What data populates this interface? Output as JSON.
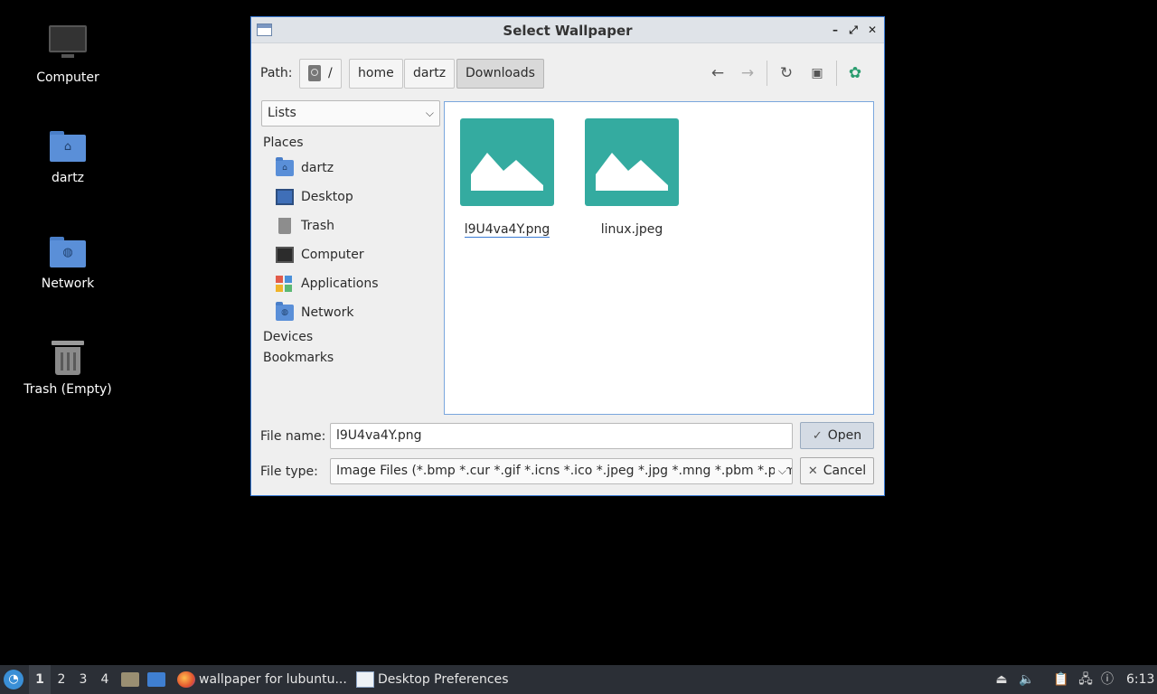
{
  "desktop": {
    "icons": [
      {
        "label": "Computer",
        "icon": "computer-icon"
      },
      {
        "label": "dartz",
        "icon": "home-folder-icon"
      },
      {
        "label": "Network",
        "icon": "network-folder-icon"
      },
      {
        "label": "Trash (Empty)",
        "icon": "trash-icon"
      }
    ]
  },
  "dialog": {
    "title": "Select Wallpaper",
    "window_buttons": {
      "minimize": "–",
      "maximize": "⤢",
      "close": "✕"
    },
    "path": {
      "label": "Path:",
      "root": "/",
      "segments": [
        "home",
        "dartz",
        "Downloads"
      ]
    },
    "view_mode": "Lists",
    "sidebar": {
      "places_title": "Places",
      "places": [
        "dartz",
        "Desktop",
        "Trash",
        "Computer",
        "Applications",
        "Network"
      ],
      "devices_title": "Devices",
      "bookmarks_title": "Bookmarks"
    },
    "files": [
      {
        "name": "l9U4va4Y.png",
        "selected": true
      },
      {
        "name": "linux.jpeg",
        "selected": false
      }
    ],
    "file_name": {
      "label": "File name:",
      "value": "l9U4va4Y.png"
    },
    "file_type": {
      "label": "File type:",
      "value": "Image Files (*.bmp *.cur *.gif *.icns *.ico *.jpeg *.jpg *.mng *.pbm *.pgm"
    },
    "buttons": {
      "open": "Open",
      "cancel": "Cancel"
    },
    "colors": {
      "accent": "#3a7bd5",
      "thumbnail": "#34aba0"
    }
  },
  "taskbar": {
    "workspaces": [
      "1",
      "2",
      "3",
      "4"
    ],
    "active_workspace": "1",
    "tasks": [
      {
        "label": "wallpaper for lubuntu...",
        "icon": "firefox-icon"
      },
      {
        "label": "Desktop Preferences",
        "icon": "window-icon"
      }
    ],
    "clock": "6:13"
  }
}
